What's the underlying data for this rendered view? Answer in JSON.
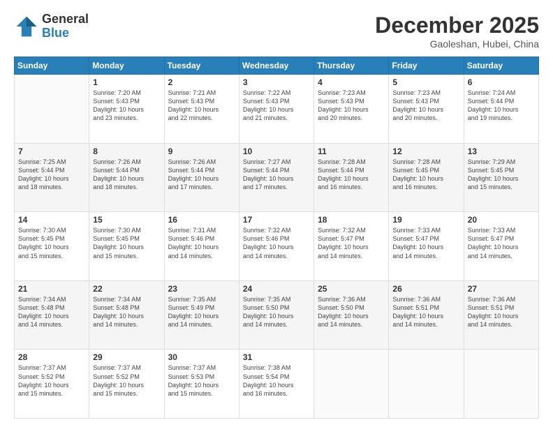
{
  "header": {
    "logo_general": "General",
    "logo_blue": "Blue",
    "month": "December 2025",
    "location": "Gaoleshan, Hubei, China"
  },
  "days_of_week": [
    "Sunday",
    "Monday",
    "Tuesday",
    "Wednesday",
    "Thursday",
    "Friday",
    "Saturday"
  ],
  "weeks": [
    [
      {
        "day": "",
        "text": ""
      },
      {
        "day": "1",
        "text": "Sunrise: 7:20 AM\nSunset: 5:43 PM\nDaylight: 10 hours\nand 23 minutes."
      },
      {
        "day": "2",
        "text": "Sunrise: 7:21 AM\nSunset: 5:43 PM\nDaylight: 10 hours\nand 22 minutes."
      },
      {
        "day": "3",
        "text": "Sunrise: 7:22 AM\nSunset: 5:43 PM\nDaylight: 10 hours\nand 21 minutes."
      },
      {
        "day": "4",
        "text": "Sunrise: 7:23 AM\nSunset: 5:43 PM\nDaylight: 10 hours\nand 20 minutes."
      },
      {
        "day": "5",
        "text": "Sunrise: 7:23 AM\nSunset: 5:43 PM\nDaylight: 10 hours\nand 20 minutes."
      },
      {
        "day": "6",
        "text": "Sunrise: 7:24 AM\nSunset: 5:44 PM\nDaylight: 10 hours\nand 19 minutes."
      }
    ],
    [
      {
        "day": "7",
        "text": "Sunrise: 7:25 AM\nSunset: 5:44 PM\nDaylight: 10 hours\nand 18 minutes."
      },
      {
        "day": "8",
        "text": "Sunrise: 7:26 AM\nSunset: 5:44 PM\nDaylight: 10 hours\nand 18 minutes."
      },
      {
        "day": "9",
        "text": "Sunrise: 7:26 AM\nSunset: 5:44 PM\nDaylight: 10 hours\nand 17 minutes."
      },
      {
        "day": "10",
        "text": "Sunrise: 7:27 AM\nSunset: 5:44 PM\nDaylight: 10 hours\nand 17 minutes."
      },
      {
        "day": "11",
        "text": "Sunrise: 7:28 AM\nSunset: 5:44 PM\nDaylight: 10 hours\nand 16 minutes."
      },
      {
        "day": "12",
        "text": "Sunrise: 7:28 AM\nSunset: 5:45 PM\nDaylight: 10 hours\nand 16 minutes."
      },
      {
        "day": "13",
        "text": "Sunrise: 7:29 AM\nSunset: 5:45 PM\nDaylight: 10 hours\nand 15 minutes."
      }
    ],
    [
      {
        "day": "14",
        "text": "Sunrise: 7:30 AM\nSunset: 5:45 PM\nDaylight: 10 hours\nand 15 minutes."
      },
      {
        "day": "15",
        "text": "Sunrise: 7:30 AM\nSunset: 5:45 PM\nDaylight: 10 hours\nand 15 minutes."
      },
      {
        "day": "16",
        "text": "Sunrise: 7:31 AM\nSunset: 5:46 PM\nDaylight: 10 hours\nand 14 minutes."
      },
      {
        "day": "17",
        "text": "Sunrise: 7:32 AM\nSunset: 5:46 PM\nDaylight: 10 hours\nand 14 minutes."
      },
      {
        "day": "18",
        "text": "Sunrise: 7:32 AM\nSunset: 5:47 PM\nDaylight: 10 hours\nand 14 minutes."
      },
      {
        "day": "19",
        "text": "Sunrise: 7:33 AM\nSunset: 5:47 PM\nDaylight: 10 hours\nand 14 minutes."
      },
      {
        "day": "20",
        "text": "Sunrise: 7:33 AM\nSunset: 5:47 PM\nDaylight: 10 hours\nand 14 minutes."
      }
    ],
    [
      {
        "day": "21",
        "text": "Sunrise: 7:34 AM\nSunset: 5:48 PM\nDaylight: 10 hours\nand 14 minutes."
      },
      {
        "day": "22",
        "text": "Sunrise: 7:34 AM\nSunset: 5:48 PM\nDaylight: 10 hours\nand 14 minutes."
      },
      {
        "day": "23",
        "text": "Sunrise: 7:35 AM\nSunset: 5:49 PM\nDaylight: 10 hours\nand 14 minutes."
      },
      {
        "day": "24",
        "text": "Sunrise: 7:35 AM\nSunset: 5:50 PM\nDaylight: 10 hours\nand 14 minutes."
      },
      {
        "day": "25",
        "text": "Sunrise: 7:36 AM\nSunset: 5:50 PM\nDaylight: 10 hours\nand 14 minutes."
      },
      {
        "day": "26",
        "text": "Sunrise: 7:36 AM\nSunset: 5:51 PM\nDaylight: 10 hours\nand 14 minutes."
      },
      {
        "day": "27",
        "text": "Sunrise: 7:36 AM\nSunset: 5:51 PM\nDaylight: 10 hours\nand 14 minutes."
      }
    ],
    [
      {
        "day": "28",
        "text": "Sunrise: 7:37 AM\nSunset: 5:52 PM\nDaylight: 10 hours\nand 15 minutes."
      },
      {
        "day": "29",
        "text": "Sunrise: 7:37 AM\nSunset: 5:52 PM\nDaylight: 10 hours\nand 15 minutes."
      },
      {
        "day": "30",
        "text": "Sunrise: 7:37 AM\nSunset: 5:53 PM\nDaylight: 10 hours\nand 15 minutes."
      },
      {
        "day": "31",
        "text": "Sunrise: 7:38 AM\nSunset: 5:54 PM\nDaylight: 10 hours\nand 16 minutes."
      },
      {
        "day": "",
        "text": ""
      },
      {
        "day": "",
        "text": ""
      },
      {
        "day": "",
        "text": ""
      }
    ]
  ]
}
